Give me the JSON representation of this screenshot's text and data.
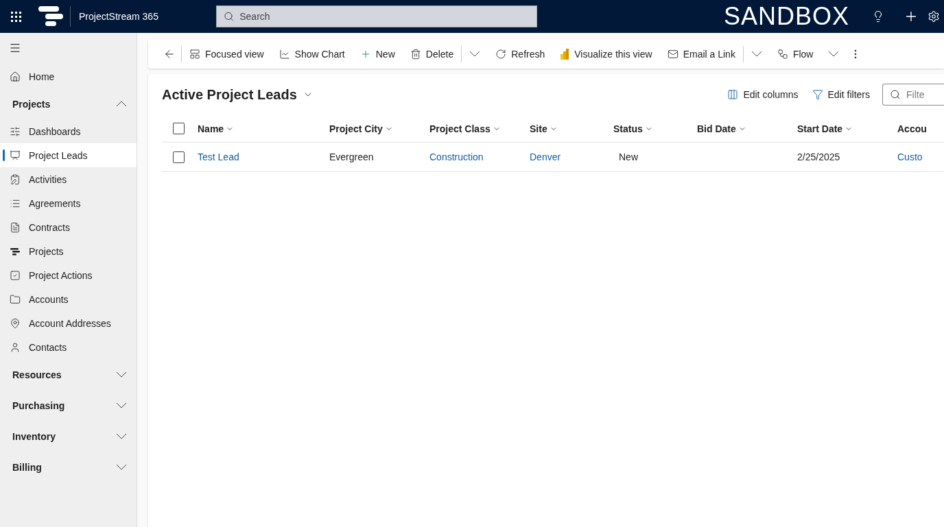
{
  "top_bar": {
    "app_name": "ProjectStream 365",
    "search": {
      "placeholder": "Search"
    },
    "environment": "SANDBOX"
  },
  "sidebar": {
    "items": [
      {
        "label": "Home",
        "selected": false
      }
    ],
    "groups": [
      {
        "label": "Projects",
        "expanded": true,
        "items": [
          {
            "label": "Dashboards",
            "selected": false
          },
          {
            "label": "Project Leads",
            "selected": true
          },
          {
            "label": "Activities",
            "selected": false
          },
          {
            "label": "Agreements",
            "selected": false
          },
          {
            "label": "Contracts",
            "selected": false
          },
          {
            "label": "Projects",
            "selected": false
          },
          {
            "label": "Project Actions",
            "selected": false
          },
          {
            "label": "Accounts",
            "selected": false
          },
          {
            "label": "Account Addresses",
            "selected": false
          },
          {
            "label": "Contacts",
            "selected": false
          }
        ]
      },
      {
        "label": "Resources",
        "expanded": false
      },
      {
        "label": "Purchasing",
        "expanded": false
      },
      {
        "label": "Inventory",
        "expanded": false
      },
      {
        "label": "Billing",
        "expanded": false
      }
    ]
  },
  "command_bar": [
    "Focused view",
    "Show Chart",
    "New",
    "Delete",
    "Refresh",
    "Visualize this view",
    "Email a Link",
    "Flow"
  ],
  "view": {
    "title": "Active Project Leads",
    "actions": [
      "Edit columns",
      "Edit filters"
    ],
    "filter": {
      "placeholder": "Filte"
    }
  },
  "table": {
    "select_all": {
      "checked": false
    },
    "columns": [
      "Name",
      "Project City",
      "Project Class",
      "Site",
      "Status",
      "Bid Date",
      "Start Date",
      "Accou"
    ],
    "rows": [
      {
        "checked": false,
        "cells": [
          {
            "kind": "link",
            "text": "Test Lead"
          },
          {
            "kind": "text",
            "text": "Evergreen"
          },
          {
            "kind": "link",
            "text": "Construction"
          },
          {
            "kind": "link",
            "text": "Denver"
          },
          {
            "kind": "text",
            "text": "New"
          },
          {
            "kind": "empty"
          },
          {
            "kind": "text",
            "text": "2/25/2025"
          },
          {
            "kind": "link",
            "text": "Custo"
          }
        ]
      }
    ]
  }
}
